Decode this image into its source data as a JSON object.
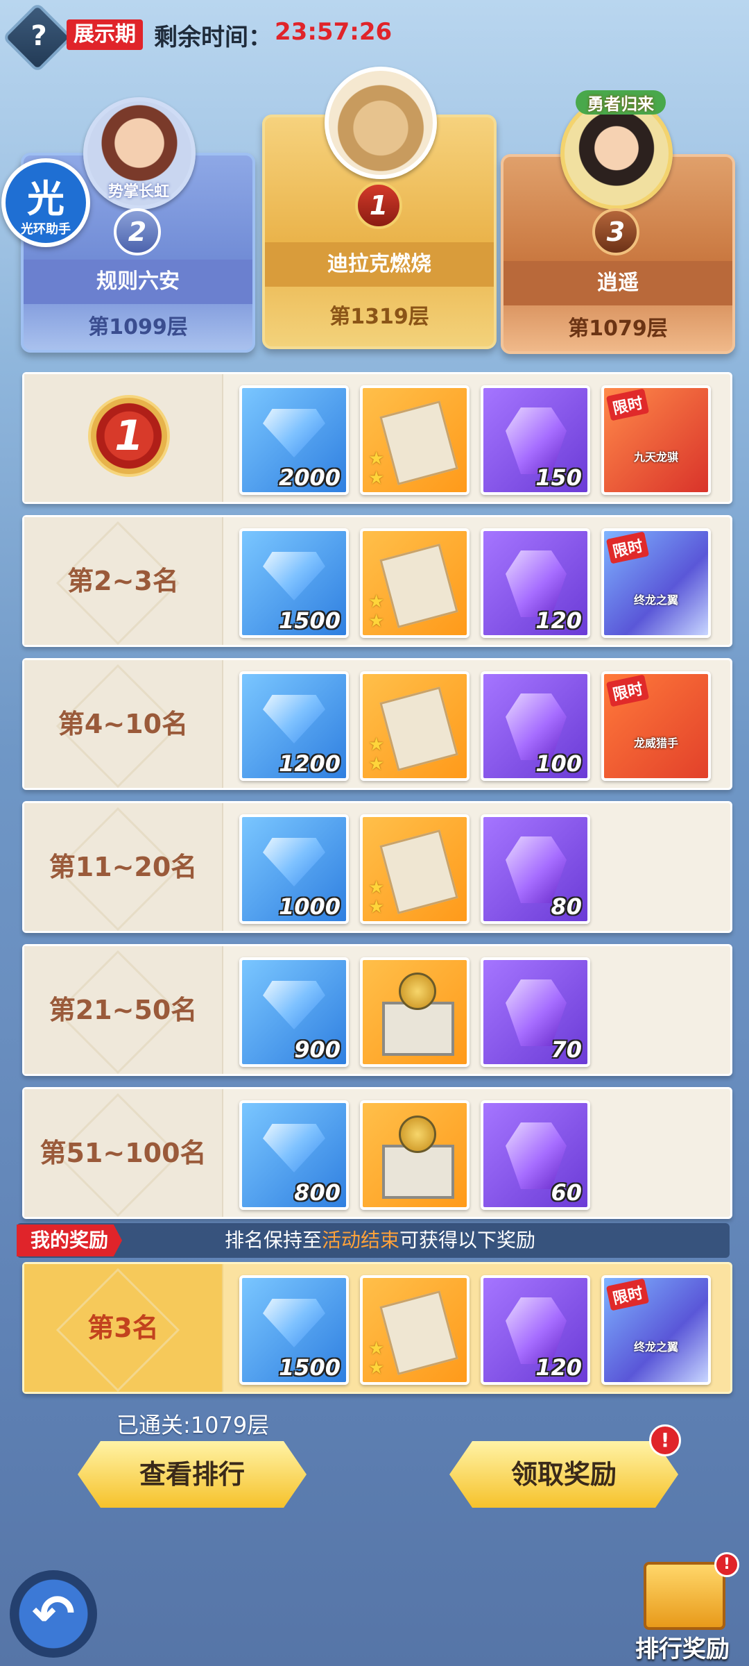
{
  "header": {
    "help_icon": "question-mark-icon",
    "help_glyph": "?",
    "phase": "展示期",
    "timer_label": "剩余时间：",
    "timer_value": "23:57:26"
  },
  "assist": {
    "big": "光",
    "small": "光环助手"
  },
  "podium": [
    {
      "rank": "2",
      "name": "规则六安",
      "floor": "第1099层",
      "guild": "势掌长虹"
    },
    {
      "rank": "1",
      "name": "迪拉克燃烧",
      "floor": "第1319层"
    },
    {
      "rank": "3",
      "name": "逍遥",
      "floor": "第1079层",
      "guild": "勇者归来"
    }
  ],
  "rewards": [
    {
      "rank_label": "",
      "rank_medal": "1",
      "items": [
        {
          "type": "diamond",
          "qty": "2000"
        },
        {
          "type": "scroll",
          "qty": ""
        },
        {
          "type": "purple",
          "qty": "150"
        },
        {
          "type": "limited",
          "tag": "限时",
          "text": "九天龙骐",
          "variant": "red"
        }
      ]
    },
    {
      "rank_label": "第2~3名",
      "items": [
        {
          "type": "diamond",
          "qty": "1500"
        },
        {
          "type": "scroll",
          "qty": ""
        },
        {
          "type": "purple",
          "qty": "120"
        },
        {
          "type": "limited",
          "tag": "限时",
          "text": "终龙之翼",
          "variant": "blue"
        }
      ]
    },
    {
      "rank_label": "第4~10名",
      "items": [
        {
          "type": "diamond",
          "qty": "1200"
        },
        {
          "type": "scroll",
          "qty": ""
        },
        {
          "type": "purple",
          "qty": "100"
        },
        {
          "type": "limited",
          "tag": "限时",
          "text": "龙威猎手",
          "variant": "orange"
        }
      ]
    },
    {
      "rank_label": "第11~20名",
      "items": [
        {
          "type": "diamond",
          "qty": "1000"
        },
        {
          "type": "scroll",
          "qty": ""
        },
        {
          "type": "purple",
          "qty": "80"
        }
      ]
    },
    {
      "rank_label": "第21~50名",
      "items": [
        {
          "type": "diamond",
          "qty": "900"
        },
        {
          "type": "box",
          "qty": ""
        },
        {
          "type": "purple",
          "qty": "70"
        }
      ]
    },
    {
      "rank_label": "第51~100名",
      "items": [
        {
          "type": "diamond",
          "qty": "800"
        },
        {
          "type": "box",
          "qty": ""
        },
        {
          "type": "purple",
          "qty": "60"
        }
      ]
    }
  ],
  "my_rewards": {
    "tag": "我的奖励",
    "note_before": "排名保持至",
    "note_highlight": "活动结束",
    "note_after": "可获得以下奖励",
    "rank_label": "第3名",
    "items": [
      {
        "type": "diamond",
        "qty": "1500"
      },
      {
        "type": "scroll",
        "qty": ""
      },
      {
        "type": "purple",
        "qty": "120"
      },
      {
        "type": "limited",
        "tag": "限时",
        "text": "终龙之翼",
        "variant": "blue"
      }
    ]
  },
  "cleared": "已通关:1079层",
  "buttons": {
    "ranking": "查看排行",
    "claim": "领取奖励",
    "gift_label": "排行奖励",
    "alert": "!"
  },
  "back_glyph": "↶",
  "colors": {
    "accent_red": "#e0242a",
    "gold": "#f6c22b"
  }
}
